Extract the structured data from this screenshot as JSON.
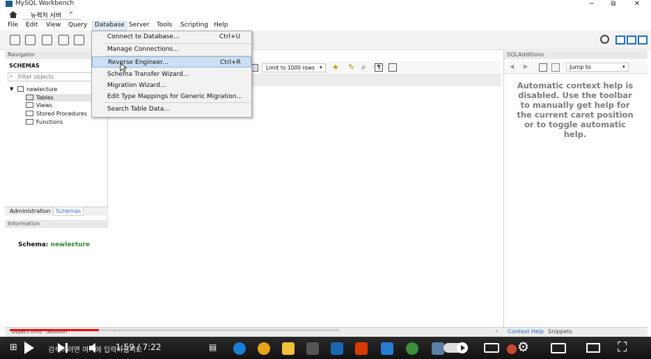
{
  "window": {
    "title": "MySQL Workbench",
    "tab_label": "뉴렉처 서버",
    "minimize": "−",
    "maximize": "⧉",
    "close": "✕"
  },
  "menubar": [
    "File",
    "Edit",
    "View",
    "Query",
    "Database",
    "Server",
    "Tools",
    "Scripting",
    "Help"
  ],
  "database_menu": {
    "items": [
      {
        "label": "Connect to Database...",
        "shortcut": "Ctrl+U"
      },
      {
        "label": "Manage Connections...",
        "shortcut": ""
      },
      {
        "label": "Reverse Engineer...",
        "shortcut": "Ctrl+R"
      },
      {
        "label": "Schema Transfer Wizard...",
        "shortcut": ""
      },
      {
        "label": "Migration Wizard...",
        "shortcut": ""
      },
      {
        "label": "Edit Type Mappings for Generic Migration...",
        "shortcut": ""
      },
      {
        "label": "Search Table Data...",
        "shortcut": ""
      }
    ],
    "highlighted": "Reverse Engineer..."
  },
  "navigator": {
    "header": "Navigator",
    "schemas_label": "SCHEMAS",
    "filter_placeholder": "Filter objects",
    "schema_name": "newlecture",
    "tree_items": [
      "Tables",
      "Views",
      "Stored Procedures",
      "Functions"
    ],
    "tabs": [
      "Administration",
      "Schemas"
    ],
    "info_header": "Information",
    "info_schema_label": "Schema:",
    "info_schema_value": "newlecture"
  },
  "editor": {
    "limit_label": "Limit to 1000 rows"
  },
  "sql_additions": {
    "header": "SQLAdditions",
    "jump_to": "Jump to",
    "help_text": "Automatic context help is disabled. Use the toolbar to manually get help for the current caret position or to toggle automatic help.",
    "bottom_tabs": [
      "Context Help",
      "Snippets"
    ]
  },
  "bottom_tabs": [
    "Object Info",
    "Session"
  ],
  "video": {
    "time": "1:59 / 7:22",
    "progress": 0.27,
    "caption": "검색하려면 여기에 입력하십시오"
  },
  "colors": {
    "accent_blue": "#1f6fbf",
    "progress_red": "#ff0000",
    "schema_green": "#2e8b2e"
  }
}
